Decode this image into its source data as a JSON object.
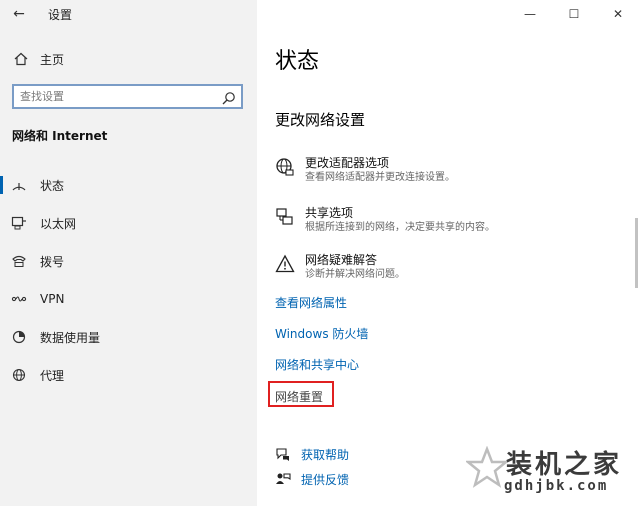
{
  "window": {
    "title": "设置",
    "back_glyph": "←",
    "minimize_glyph": "—",
    "maximize_glyph": "☐",
    "close_glyph": "✕"
  },
  "sidebar": {
    "home_label": "主页",
    "search_placeholder": "查找设置",
    "section_title": "网络和 Internet",
    "items": [
      {
        "label": "状态",
        "icon": "status-icon",
        "active": true
      },
      {
        "label": "以太网",
        "icon": "ethernet-icon"
      },
      {
        "label": "拨号",
        "icon": "dialup-icon"
      },
      {
        "label": "VPN",
        "icon": "vpn-icon"
      },
      {
        "label": "数据使用量",
        "icon": "data-usage-icon"
      },
      {
        "label": "代理",
        "icon": "proxy-icon"
      }
    ]
  },
  "main": {
    "page_title": "状态",
    "section_title": "更改网络设置",
    "options": [
      {
        "name": "更改适配器选项",
        "desc": "查看网络适配器并更改连接设置。",
        "icon": "globe-icon"
      },
      {
        "name": "共享选项",
        "desc": "根据所连接到的网络，决定要共享的内容。",
        "icon": "sharing-icon"
      },
      {
        "name": "网络疑难解答",
        "desc": "诊断并解决网络问题。",
        "icon": "warning-icon"
      }
    ],
    "links": [
      {
        "label": "查看网络属性"
      },
      {
        "label": "Windows 防火墙"
      },
      {
        "label": "网络和共享中心"
      }
    ],
    "reset_label": "网络重置",
    "help": [
      {
        "label": "获取帮助",
        "icon": "help-chat-icon"
      },
      {
        "label": "提供反馈",
        "icon": "feedback-icon"
      }
    ]
  },
  "watermark": {
    "text": "装机之家",
    "url": "gdhjbk.com"
  },
  "colors": {
    "accent": "#0063b1",
    "sidebar_bg": "#f2f2f2",
    "highlight_box": "#e02020"
  }
}
